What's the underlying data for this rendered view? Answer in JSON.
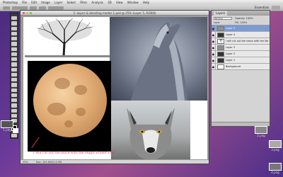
{
  "menubar": {
    "items": [
      "Photoshop",
      "File",
      "Edit",
      "Image",
      "Layer",
      "Select",
      "Filter",
      "Analysis",
      "3D",
      "View",
      "Window",
      "Help"
    ]
  },
  "optionsbar": {
    "workspace": "Essentials"
  },
  "document": {
    "title": "5. layers & blending modes 1.psd @ 25% (Layer 5, RGB/8)",
    "zoom": "25%",
    "doc_size": "Doc: 105.6M/215.9M"
  },
  "canvas": {
    "caption": "I will cut out the black with the Magic Eraser Tool"
  },
  "layers_panel": {
    "tab_label": "Layers",
    "blend_mode": "Normal",
    "opacity_label": "Opacity:",
    "opacity_value": "100%",
    "lock_label": "Lock:",
    "fill_label": "Fill:",
    "fill_value": "100%",
    "layers": [
      {
        "name": "Layer 5",
        "thumb": "grey",
        "selected": true
      },
      {
        "name": "Layer 4",
        "thumb": "dark",
        "selected": false
      },
      {
        "name": "I will cut out the black with the Magic Eraser Tool",
        "thumb": "text",
        "selected": false
      },
      {
        "name": "Layer 3",
        "thumb": "grey",
        "selected": false
      },
      {
        "name": "Layer 2",
        "thumb": "dark",
        "selected": false
      },
      {
        "name": "Layer 1",
        "thumb": "dark",
        "selected": false
      },
      {
        "name": "Background",
        "thumb": "white",
        "selected": false
      }
    ]
  },
  "desktop_icons": [
    {
      "label": "1.png"
    },
    {
      "label": "2.png"
    },
    {
      "label": "3.png"
    },
    {
      "label": "4.png"
    }
  ],
  "colors": {
    "caption": "#e8335a",
    "selected_layer": "#7b9bd6"
  }
}
